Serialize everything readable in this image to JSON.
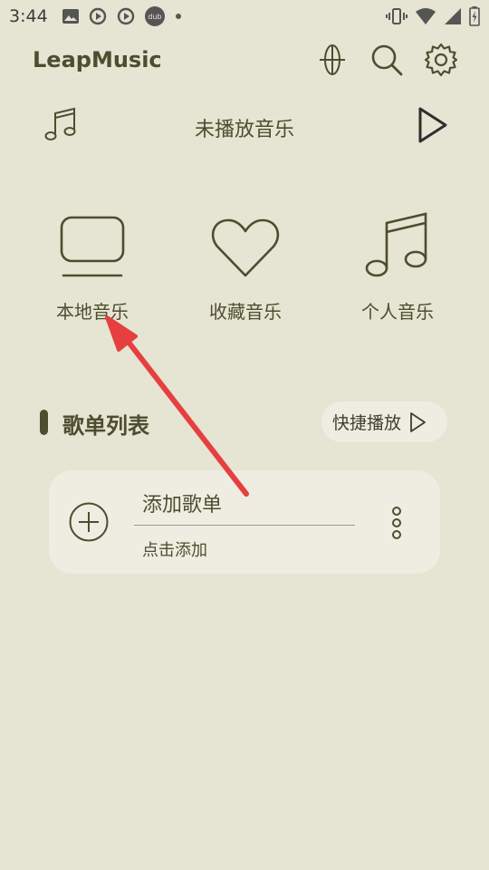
{
  "status_bar": {
    "time": "3:44",
    "left_icons": [
      "image-icon",
      "sync-play-icon",
      "sync-play-icon",
      "dub-icon",
      "dot-icon"
    ],
    "dub_text": "dub",
    "right_icons": [
      "vibrate-icon",
      "wifi-icon",
      "signal-icon",
      "battery-icon"
    ]
  },
  "app_bar": {
    "title": "LeapMusic",
    "actions": [
      "globe-icon",
      "search-icon",
      "gear-icon"
    ]
  },
  "now_playing": {
    "text": "未播放音乐"
  },
  "categories": [
    {
      "label": "本地音乐",
      "icon": "tv-icon"
    },
    {
      "label": "收藏音乐",
      "icon": "heart-icon"
    },
    {
      "label": "个人音乐",
      "icon": "music-note-icon"
    }
  ],
  "playlist_section": {
    "title": "歌单列表",
    "quick_play_label": "快捷播放"
  },
  "add_playlist_card": {
    "title": "添加歌单",
    "subtitle": "点击添加"
  },
  "colors": {
    "background": "#e6e4d2",
    "card": "#efede1",
    "text": "#4d4d30",
    "annotation_arrow": "#e5403f"
  }
}
